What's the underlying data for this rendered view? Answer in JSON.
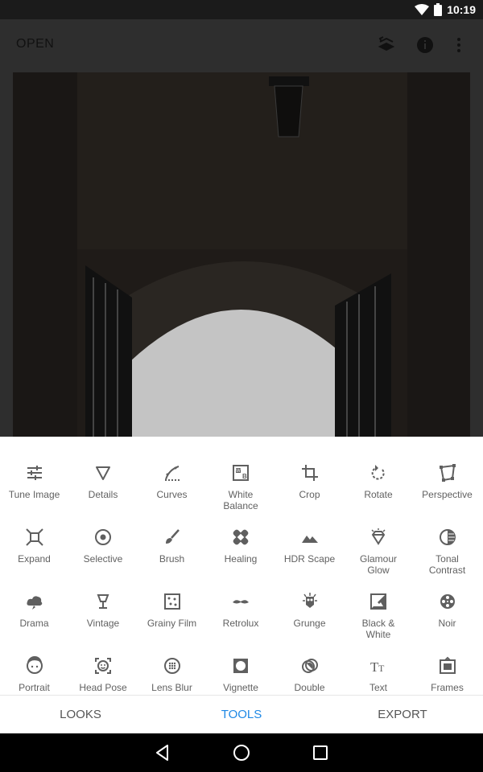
{
  "status_bar": {
    "time": "10:19",
    "icons": [
      "wifi-icon",
      "battery-icon"
    ]
  },
  "top_bar": {
    "open_label": "OPEN",
    "icons": [
      "stacks-icon",
      "info-icon",
      "more-vert-icon"
    ]
  },
  "tools": [
    {
      "label": "Tune Image",
      "icon": "tune-icon"
    },
    {
      "label": "Details",
      "icon": "details-triangle-icon"
    },
    {
      "label": "Curves",
      "icon": "curves-icon"
    },
    {
      "label": "White\nBalance",
      "icon": "white-balance-icon"
    },
    {
      "label": "Crop",
      "icon": "crop-icon"
    },
    {
      "label": "Rotate",
      "icon": "rotate-icon"
    },
    {
      "label": "Perspective",
      "icon": "perspective-icon"
    },
    {
      "label": "Expand",
      "icon": "expand-icon"
    },
    {
      "label": "Selective",
      "icon": "selective-icon"
    },
    {
      "label": "Brush",
      "icon": "brush-icon"
    },
    {
      "label": "Healing",
      "icon": "healing-icon"
    },
    {
      "label": "HDR Scape",
      "icon": "hdr-mountains-icon"
    },
    {
      "label": "Glamour\nGlow",
      "icon": "glamour-glow-icon"
    },
    {
      "label": "Tonal\nContrast",
      "icon": "tonal-contrast-icon"
    },
    {
      "label": "Drama",
      "icon": "drama-cloud-icon"
    },
    {
      "label": "Vintage",
      "icon": "vintage-lamp-icon"
    },
    {
      "label": "Grainy Film",
      "icon": "grainy-film-icon"
    },
    {
      "label": "Retrolux",
      "icon": "retrolux-mustache-icon"
    },
    {
      "label": "Grunge",
      "icon": "grunge-icon"
    },
    {
      "label": "Black &\nWhite",
      "icon": "black-white-icon"
    },
    {
      "label": "Noir",
      "icon": "noir-film-reel-icon"
    },
    {
      "label": "Portrait",
      "icon": "portrait-face-icon"
    },
    {
      "label": "Head Pose",
      "icon": "head-pose-icon"
    },
    {
      "label": "Lens Blur",
      "icon": "lens-blur-icon"
    },
    {
      "label": "Vignette",
      "icon": "vignette-icon"
    },
    {
      "label": "Double",
      "icon": "double-exposure-icon"
    },
    {
      "label": "Text",
      "icon": "text-icon"
    },
    {
      "label": "Frames",
      "icon": "frames-icon"
    }
  ],
  "bottom_nav": {
    "looks": "LOOKS",
    "tools": "TOOLS",
    "export": "EXPORT",
    "active": "TOOLS"
  },
  "colors": {
    "accent": "#1e88e5",
    "icon": "#5f5f5f",
    "label": "#616161",
    "scrim": "#2e2e2e"
  }
}
